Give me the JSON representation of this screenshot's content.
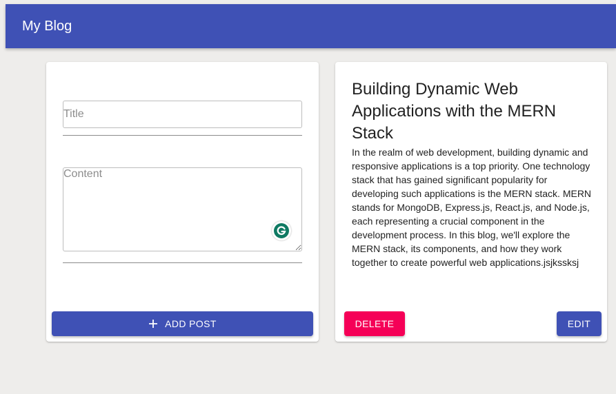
{
  "app": {
    "title": "My Blog"
  },
  "form": {
    "title_placeholder": "Title",
    "title_value": "",
    "content_placeholder": "Content",
    "content_value": "",
    "add_button_label": "ADD POST",
    "add_icon": "plus-icon",
    "grammarly_icon": "grammarly-icon"
  },
  "post": {
    "title": "Building Dynamic Web Applications with the MERN Stack",
    "content": "In the realm of web development, building dynamic and responsive applications is a top priority. One technology stack that has gained significant popularity for developing such applications is the MERN stack. MERN stands for MongoDB, Express.js, React.js, and Node.js, each representing a crucial component in the development process. In this blog, we'll explore the MERN stack, its components, and how they work together to create powerful web applications.jsjkssksj",
    "delete_label": "DELETE",
    "edit_label": "EDIT"
  },
  "colors": {
    "primary": "#3f51b5",
    "secondary": "#f50057",
    "background": "#eeedeb",
    "grammarly": "#15c39a"
  }
}
